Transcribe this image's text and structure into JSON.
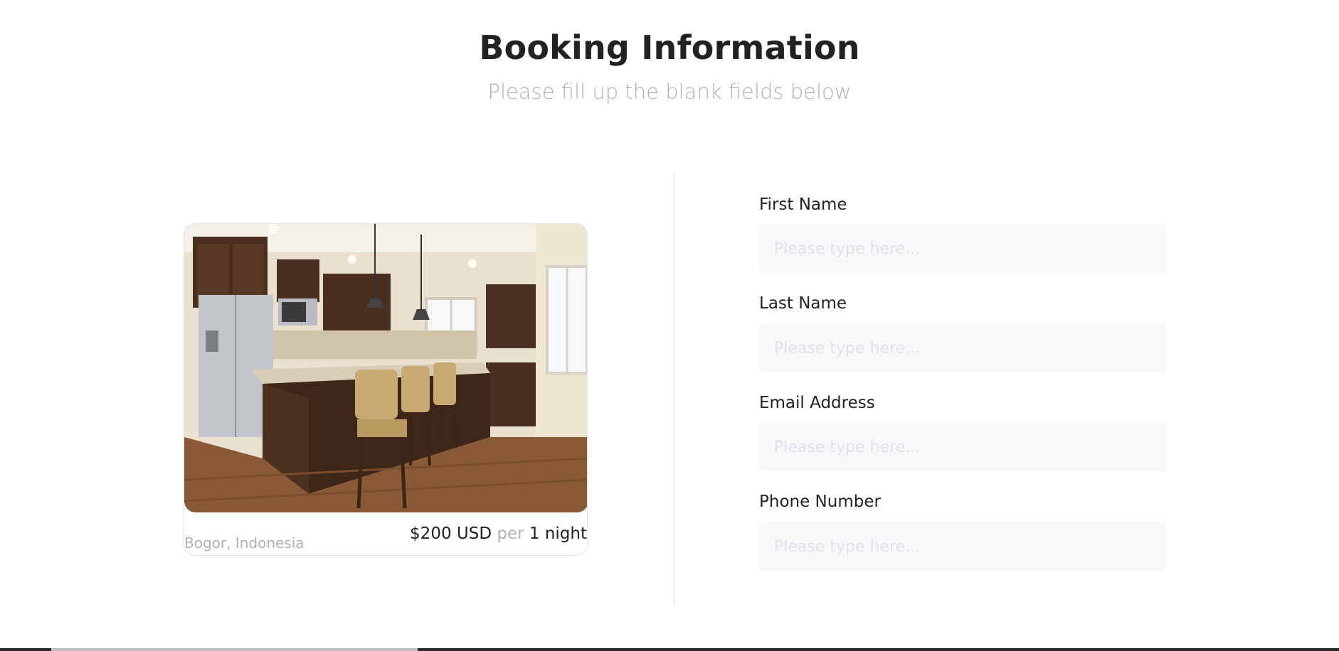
{
  "header": {
    "title": "Booking Information",
    "subtitle": "Please fill up the blank fields below"
  },
  "property": {
    "image_alt": "Kitchen interior",
    "location": "Bogor, Indonesia",
    "price": "$200 USD",
    "per": "per",
    "duration": "1 night"
  },
  "form": {
    "fields": [
      {
        "label": "First Name",
        "placeholder": "Please type here..."
      },
      {
        "label": "Last Name",
        "placeholder": "Please type here..."
      },
      {
        "label": "Email Address",
        "placeholder": "Please type here..."
      },
      {
        "label": "Phone Number",
        "placeholder": "Please type here..."
      }
    ]
  },
  "colors": {
    "title": "#222222",
    "muted": "#b0b0b0",
    "input_bg": "#f7f8fa"
  }
}
